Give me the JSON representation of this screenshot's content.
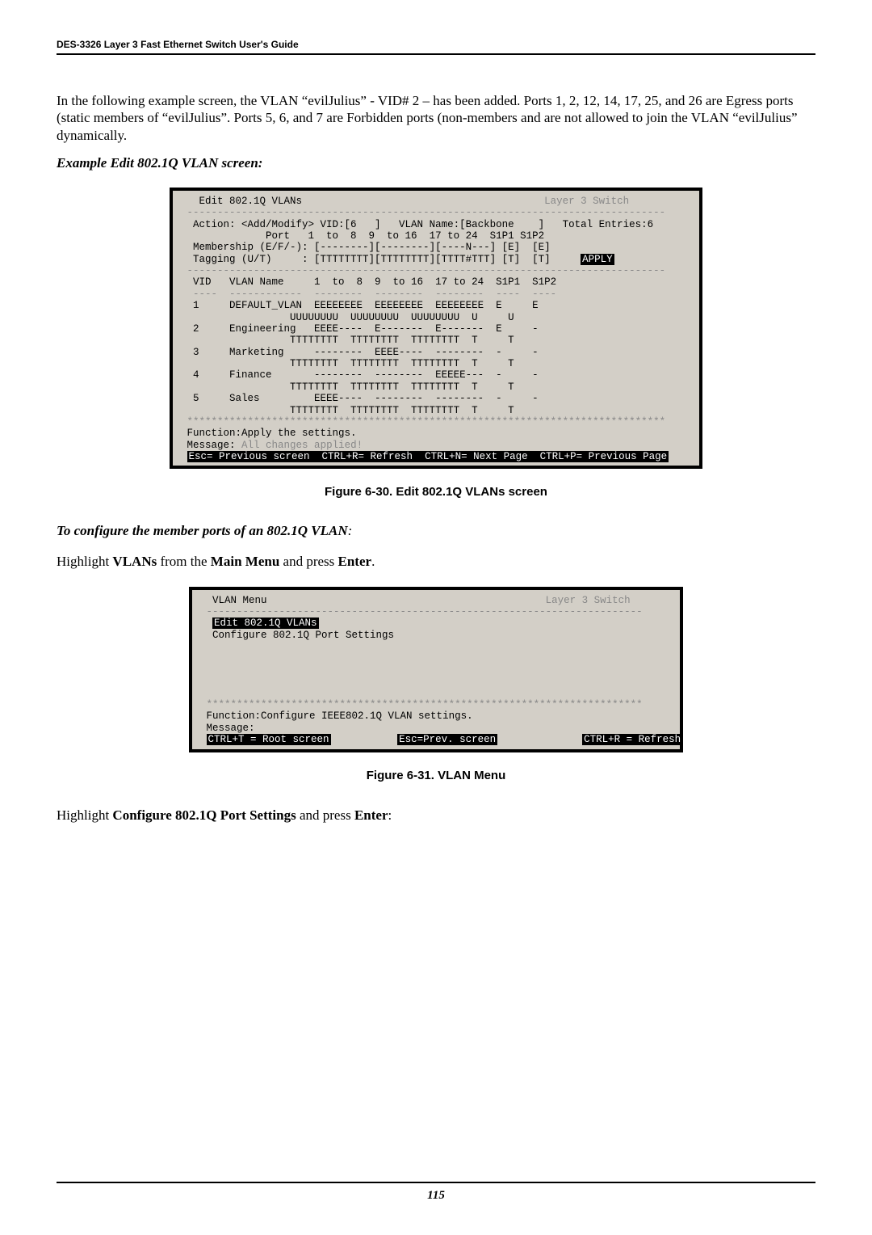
{
  "header": {
    "title": "DES-3326 Layer 3 Fast Ethernet Switch User's Guide"
  },
  "body": {
    "intro": "In the following example screen, the VLAN “evilJulius” - VID# 2 – has been added.  Ports 1, 2, 12, 14, 17, 25, and 26 are Egress ports (static members of “evilJulius”.  Ports 5, 6, and 7 are Forbidden ports (non-members and are not allowed to join the VLAN “evilJulius” dynamically.",
    "heading1": "Example Edit 802.1Q VLAN screen:",
    "heading2a": "To configure the member ports of an 802.1Q VLAN",
    "heading2b": ":",
    "hl1": {
      "a": "Highlight",
      "b1": "VLANs",
      "c": "from the",
      "b2": "Main Menu",
      "d": "and press",
      "b3": "Enter",
      "e": "."
    },
    "hl2": {
      "a": "Highlight",
      "b1": "Configure 802.1Q Port Settings",
      "c": "and press",
      "b2": "Enter",
      "d": ":"
    }
  },
  "terminal1": {
    "title": "Edit 802.1Q VLANs",
    "switch": "Layer 3 Switch",
    "dash": "-------------------------------------------------------------------------------",
    "actionLine": "Action: <Add/Modify> VID:[6   ]   VLAN Name:[Backbone    ]   Total Entries:6",
    "portHeader": "Port   1  to  8  9  to 16  17 to 24  S1P1 S1P2",
    "membership": "Membership (E/F/-): [--------][--------][----N---] [E]  [E]",
    "tagging": "Tagging (U/T)     : [TTTTTTTT][TTTTTTTT][TTTT#TTT] [T]  [T]",
    "apply": "APPLY",
    "cols": "VID   VLAN Name     1  to  8  9  to 16  17 to 24  S1P1  S1P2",
    "underline": "----  ------------  --------  --------  --------  ----  ----",
    "r1a": "1     DEFAULT_VLAN  EEEEEEEE  EEEEEEEE  EEEEEEEE  E     E",
    "r1b": "UUUUUUUU  UUUUUUUU  UUUUUUUU  U     U",
    "r2a": "2     Engineering   EEEE----  E-------  E-------  E     -",
    "r2b": "TTTTTTTT  TTTTTTTT  TTTTTTTT  T     T",
    "r3a": "3     Marketing     --------  EEEE----  --------  -     -",
    "r3b": "TTTTTTTT  TTTTTTTT  TTTTTTTT  T     T",
    "r4a": "4     Finance       --------  --------  EEEEE---  -     -",
    "r4b": "TTTTTTTT  TTTTTTTT  TTTTTTTT  T     T",
    "r5a": "5     Sales         EEEE----  --------  --------  -     -",
    "r5b": "TTTTTTTT  TTTTTTTT  TTTTTTTT  T     T",
    "sep": "*******************************************************************************",
    "fn": "Function:Apply the settings.",
    "msgLabel": "Message:",
    "msg": "All changes applied!",
    "nav": "Esc= Previous screen  CTRL+R= Refresh  CTRL+N= Next Page  CTRL+P= Previous Page"
  },
  "terminal2": {
    "title": "VLAN Menu",
    "switch": "Layer 3 Switch",
    "dash": "------------------------------------------------------------------------",
    "item1": "Edit 802.1Q VLANs",
    "item2": "Configure 802.1Q Port Settings",
    "sep": "************************************************************************",
    "fn": "Function:Configure IEEE802.1Q VLAN settings.",
    "msgLabel": "Message:",
    "navA": "CTRL+T = Root screen",
    "navB": "Esc=Prev. screen",
    "navC": "CTRL+R = Refresh"
  },
  "captions": {
    "fig1": "Figure 6-30. Edit 802.1Q VLANs screen",
    "fig2": "Figure 6-31.  VLAN Menu"
  },
  "footer": {
    "page": "115"
  }
}
